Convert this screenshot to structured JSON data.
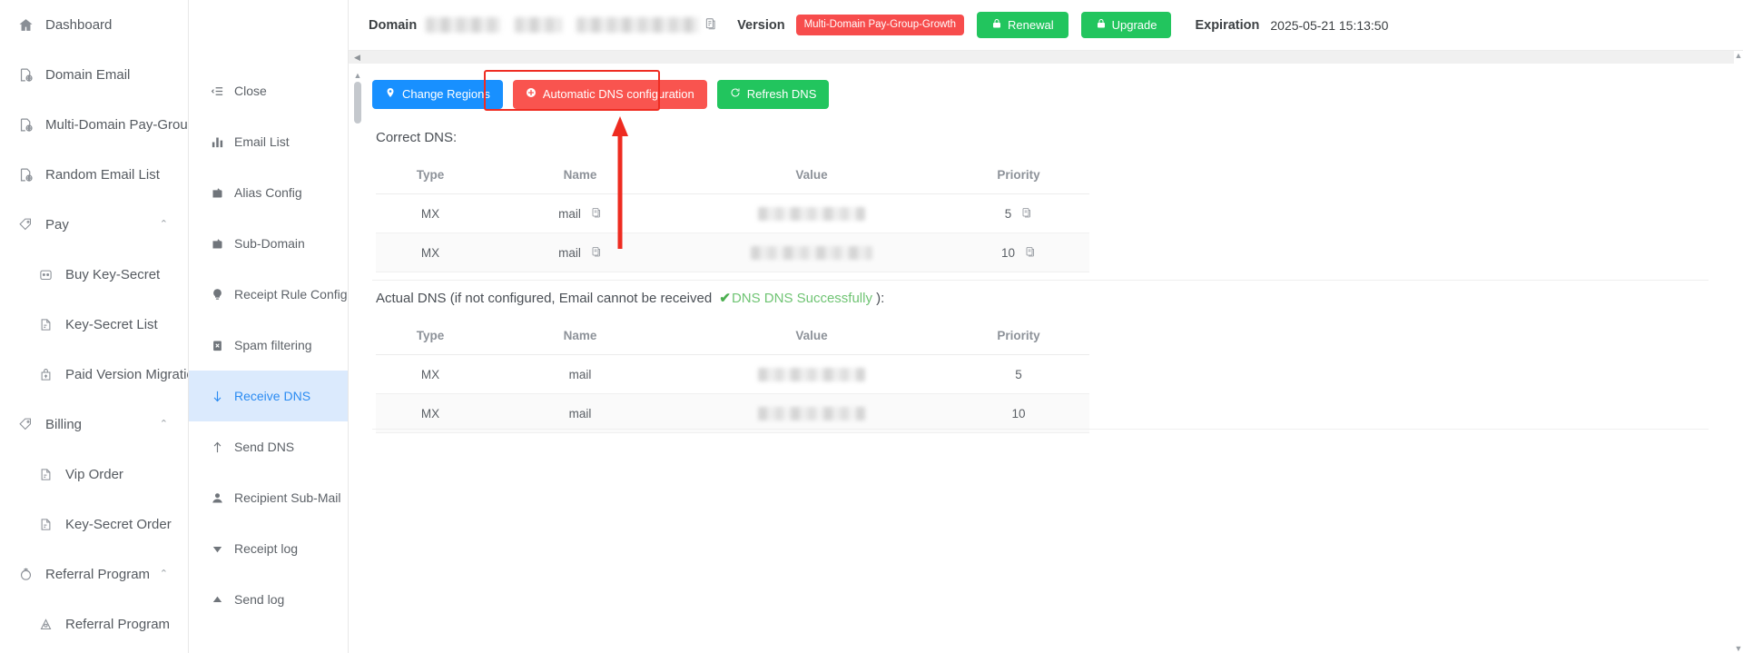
{
  "sidebar": {
    "items": [
      {
        "label": "Dashboard",
        "icon": "home-icon",
        "level": 0,
        "expandable": false
      },
      {
        "label": "Domain Email",
        "icon": "domain-mail-icon",
        "level": 0,
        "expandable": false
      },
      {
        "label": "Multi-Domain Pay-Group",
        "icon": "domain-mail-icon",
        "level": 0,
        "expandable": false
      },
      {
        "label": "Random Email List",
        "icon": "domain-mail-icon",
        "level": 0,
        "expandable": false
      },
      {
        "label": "Pay",
        "icon": "tag-icon",
        "level": 0,
        "expandable": true,
        "chevron": "⌃"
      },
      {
        "label": "Buy Key-Secret",
        "icon": "robot-icon",
        "level": 1,
        "expandable": false
      },
      {
        "label": "Key-Secret List",
        "icon": "doc-icon",
        "level": 1,
        "expandable": false
      },
      {
        "label": "Paid Version Migration",
        "icon": "upload-bag-icon",
        "level": 1,
        "expandable": false
      },
      {
        "label": "Billing",
        "icon": "tag-icon",
        "level": 0,
        "expandable": true,
        "chevron": "⌃"
      },
      {
        "label": "Vip Order",
        "icon": "doc-icon",
        "level": 1,
        "expandable": false
      },
      {
        "label": "Key-Secret Order",
        "icon": "doc-icon",
        "level": 1,
        "expandable": false
      },
      {
        "label": "Referral Program",
        "icon": "gift-icon",
        "level": 0,
        "expandable": true,
        "chevron": "⌃"
      },
      {
        "label": "Referral Program",
        "icon": "share-icon",
        "level": 1,
        "expandable": false
      }
    ]
  },
  "submenu": {
    "items": [
      {
        "label": "Close",
        "icon": "collapse-icon",
        "active": false
      },
      {
        "label": "Email List",
        "icon": "bar-chart-icon",
        "active": false
      },
      {
        "label": "Alias Config",
        "icon": "wallet-icon",
        "active": false
      },
      {
        "label": "Sub-Domain",
        "icon": "wallet-icon",
        "active": false
      },
      {
        "label": "Receipt Rule Config",
        "icon": "bulb-icon",
        "active": false
      },
      {
        "label": "Spam filtering",
        "icon": "clipboard-x-icon",
        "active": false
      },
      {
        "label": "Receive DNS",
        "icon": "arrow-down-icon",
        "active": true
      },
      {
        "label": "Send DNS",
        "icon": "arrow-up-icon",
        "active": false
      },
      {
        "label": "Recipient Sub-Mail",
        "icon": "user-icon",
        "active": false
      },
      {
        "label": "Receipt log",
        "icon": "caret-down-icon",
        "active": false
      },
      {
        "label": "Send log",
        "icon": "caret-up-icon",
        "active": false
      }
    ]
  },
  "header": {
    "domain_label": "Domain",
    "domain_value": "",
    "copy_icon": "copy-icon",
    "version_label": "Version",
    "version_badge": "Multi-Domain Pay-Group-Growth",
    "renewal_button": "Renewal",
    "upgrade_button": "Upgrade",
    "lock_icon": "lock-icon",
    "expiration_label": "Expiration",
    "expiration_value": "2025-05-21 15:13:50"
  },
  "toolbar": {
    "change_regions": "Change Regions",
    "change_regions_icon": "location-pin-icon",
    "automatic_dns": "Automatic DNS configuration",
    "automatic_dns_icon": "plus-circle-icon",
    "refresh_dns": "Refresh DNS",
    "refresh_dns_icon": "refresh-icon",
    "highlight_color": "#ef2d23"
  },
  "correct_dns": {
    "title": "Correct DNS:",
    "columns": [
      "Type",
      "Name",
      "Value",
      "Priority"
    ],
    "rows": [
      {
        "type": "MX",
        "name": "mail",
        "value": "",
        "priority": "5",
        "name_copy": true,
        "priority_copy": true
      },
      {
        "type": "MX",
        "name": "mail",
        "value": "",
        "priority": "10",
        "name_copy": true,
        "priority_copy": true
      }
    ]
  },
  "actual_dns": {
    "title_prefix": "Actual DNS (if not configured, Email cannot be received ",
    "status_text": "DNS DNS Successfully",
    "status_icon": "check-circle-icon",
    "status_color": "#6fc473",
    "title_suffix": " ):",
    "columns": [
      "Type",
      "Name",
      "Value",
      "Priority"
    ],
    "rows": [
      {
        "type": "MX",
        "name": "mail",
        "value": "",
        "priority": "5"
      },
      {
        "type": "MX",
        "name": "mail",
        "value": "",
        "priority": "10"
      }
    ]
  },
  "colors": {
    "blue": "#1890ff",
    "red": "#f9544f",
    "green": "#22c55e",
    "badge_red": "#f74c4c",
    "active_bg": "#dbeafd",
    "active_fg": "#2a8bf2"
  }
}
